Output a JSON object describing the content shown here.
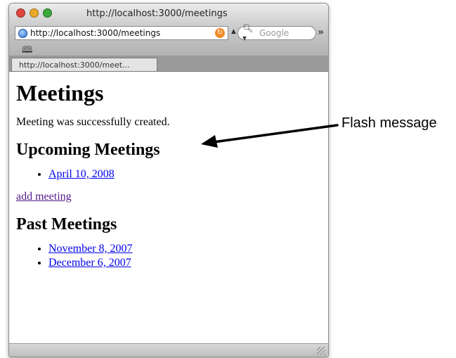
{
  "window": {
    "title": "http://localhost:3000/meetings",
    "traffic_lights": {
      "close": "#e0443e",
      "minimize": "#e9a928",
      "zoom": "#3aa83a"
    }
  },
  "toolbar": {
    "url": "http://localhost:3000/meetings",
    "search_placeholder": "Google",
    "overflow": "»"
  },
  "bookmarks": {
    "icon": "book-icon"
  },
  "tab": {
    "label": "http://localhost:3000/meet..."
  },
  "page": {
    "title": "Meetings",
    "flash": "Meeting was successfully created.",
    "upcoming_heading": "Upcoming Meetings",
    "upcoming": [
      "April 10, 2008"
    ],
    "add_link": "add meeting",
    "past_heading": "Past Meetings",
    "past": [
      "November 8, 2007",
      "December 6, 2007"
    ]
  },
  "annotation": {
    "label": "Flash message"
  }
}
